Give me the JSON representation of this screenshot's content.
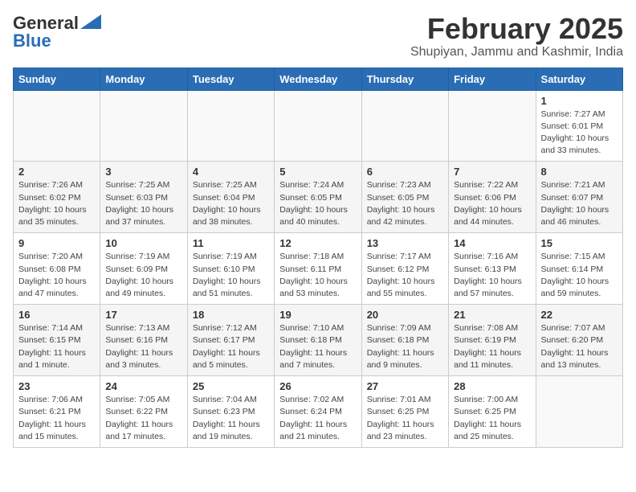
{
  "header": {
    "logo_general": "General",
    "logo_blue": "Blue",
    "month_year": "February 2025",
    "location": "Shupiyan, Jammu and Kashmir, India"
  },
  "weekdays": [
    "Sunday",
    "Monday",
    "Tuesday",
    "Wednesday",
    "Thursday",
    "Friday",
    "Saturday"
  ],
  "weeks": [
    [
      {
        "day": "",
        "info": ""
      },
      {
        "day": "",
        "info": ""
      },
      {
        "day": "",
        "info": ""
      },
      {
        "day": "",
        "info": ""
      },
      {
        "day": "",
        "info": ""
      },
      {
        "day": "",
        "info": ""
      },
      {
        "day": "1",
        "info": "Sunrise: 7:27 AM\nSunset: 6:01 PM\nDaylight: 10 hours\nand 33 minutes."
      }
    ],
    [
      {
        "day": "2",
        "info": "Sunrise: 7:26 AM\nSunset: 6:02 PM\nDaylight: 10 hours\nand 35 minutes."
      },
      {
        "day": "3",
        "info": "Sunrise: 7:25 AM\nSunset: 6:03 PM\nDaylight: 10 hours\nand 37 minutes."
      },
      {
        "day": "4",
        "info": "Sunrise: 7:25 AM\nSunset: 6:04 PM\nDaylight: 10 hours\nand 38 minutes."
      },
      {
        "day": "5",
        "info": "Sunrise: 7:24 AM\nSunset: 6:05 PM\nDaylight: 10 hours\nand 40 minutes."
      },
      {
        "day": "6",
        "info": "Sunrise: 7:23 AM\nSunset: 6:05 PM\nDaylight: 10 hours\nand 42 minutes."
      },
      {
        "day": "7",
        "info": "Sunrise: 7:22 AM\nSunset: 6:06 PM\nDaylight: 10 hours\nand 44 minutes."
      },
      {
        "day": "8",
        "info": "Sunrise: 7:21 AM\nSunset: 6:07 PM\nDaylight: 10 hours\nand 46 minutes."
      }
    ],
    [
      {
        "day": "9",
        "info": "Sunrise: 7:20 AM\nSunset: 6:08 PM\nDaylight: 10 hours\nand 47 minutes."
      },
      {
        "day": "10",
        "info": "Sunrise: 7:19 AM\nSunset: 6:09 PM\nDaylight: 10 hours\nand 49 minutes."
      },
      {
        "day": "11",
        "info": "Sunrise: 7:19 AM\nSunset: 6:10 PM\nDaylight: 10 hours\nand 51 minutes."
      },
      {
        "day": "12",
        "info": "Sunrise: 7:18 AM\nSunset: 6:11 PM\nDaylight: 10 hours\nand 53 minutes."
      },
      {
        "day": "13",
        "info": "Sunrise: 7:17 AM\nSunset: 6:12 PM\nDaylight: 10 hours\nand 55 minutes."
      },
      {
        "day": "14",
        "info": "Sunrise: 7:16 AM\nSunset: 6:13 PM\nDaylight: 10 hours\nand 57 minutes."
      },
      {
        "day": "15",
        "info": "Sunrise: 7:15 AM\nSunset: 6:14 PM\nDaylight: 10 hours\nand 59 minutes."
      }
    ],
    [
      {
        "day": "16",
        "info": "Sunrise: 7:14 AM\nSunset: 6:15 PM\nDaylight: 11 hours\nand 1 minute."
      },
      {
        "day": "17",
        "info": "Sunrise: 7:13 AM\nSunset: 6:16 PM\nDaylight: 11 hours\nand 3 minutes."
      },
      {
        "day": "18",
        "info": "Sunrise: 7:12 AM\nSunset: 6:17 PM\nDaylight: 11 hours\nand 5 minutes."
      },
      {
        "day": "19",
        "info": "Sunrise: 7:10 AM\nSunset: 6:18 PM\nDaylight: 11 hours\nand 7 minutes."
      },
      {
        "day": "20",
        "info": "Sunrise: 7:09 AM\nSunset: 6:18 PM\nDaylight: 11 hours\nand 9 minutes."
      },
      {
        "day": "21",
        "info": "Sunrise: 7:08 AM\nSunset: 6:19 PM\nDaylight: 11 hours\nand 11 minutes."
      },
      {
        "day": "22",
        "info": "Sunrise: 7:07 AM\nSunset: 6:20 PM\nDaylight: 11 hours\nand 13 minutes."
      }
    ],
    [
      {
        "day": "23",
        "info": "Sunrise: 7:06 AM\nSunset: 6:21 PM\nDaylight: 11 hours\nand 15 minutes."
      },
      {
        "day": "24",
        "info": "Sunrise: 7:05 AM\nSunset: 6:22 PM\nDaylight: 11 hours\nand 17 minutes."
      },
      {
        "day": "25",
        "info": "Sunrise: 7:04 AM\nSunset: 6:23 PM\nDaylight: 11 hours\nand 19 minutes."
      },
      {
        "day": "26",
        "info": "Sunrise: 7:02 AM\nSunset: 6:24 PM\nDaylight: 11 hours\nand 21 minutes."
      },
      {
        "day": "27",
        "info": "Sunrise: 7:01 AM\nSunset: 6:25 PM\nDaylight: 11 hours\nand 23 minutes."
      },
      {
        "day": "28",
        "info": "Sunrise: 7:00 AM\nSunset: 6:25 PM\nDaylight: 11 hours\nand 25 minutes."
      },
      {
        "day": "",
        "info": ""
      }
    ]
  ]
}
